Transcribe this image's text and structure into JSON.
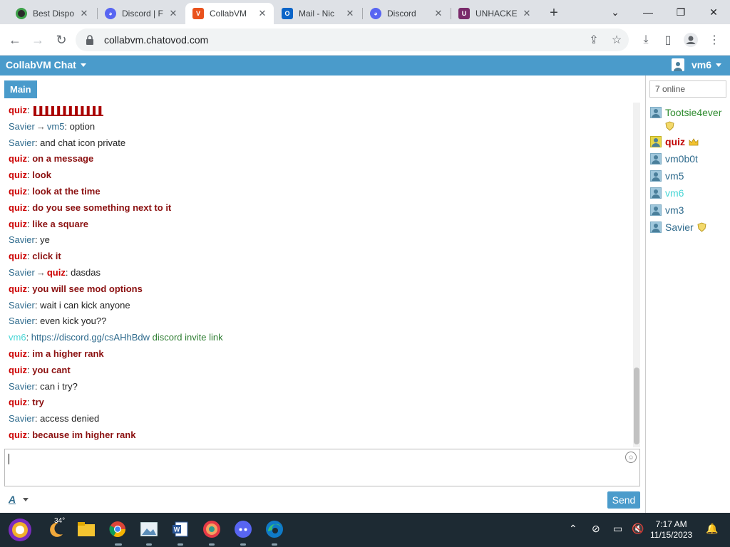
{
  "browser": {
    "tabs": [
      {
        "title": "Best Dispo",
        "icon": "xbox-icon"
      },
      {
        "title": "Discord | F",
        "icon": "discord-icon"
      },
      {
        "title": "CollabVM",
        "icon": "collabvm-icon"
      },
      {
        "title": "Mail - Nic",
        "icon": "outlook-icon"
      },
      {
        "title": "Discord",
        "icon": "discord-icon"
      },
      {
        "title": "UNHACKE",
        "icon": "unhacked-icon"
      }
    ],
    "active_tab": 2,
    "url": "collabvm.chatovod.com"
  },
  "app": {
    "title": "CollabVM Chat",
    "username": "vm6",
    "accent_color": "#4a9bcb"
  },
  "chat": {
    "room_tab": "Main",
    "messages": [
      {
        "from": "quiz",
        "text": "",
        "kind": "garbled"
      },
      {
        "from": "Savier",
        "to": "vm5",
        "text": "option"
      },
      {
        "from": "Savier",
        "text": "and chat icon private"
      },
      {
        "from": "quiz",
        "text": "on a message"
      },
      {
        "from": "quiz",
        "text": "look"
      },
      {
        "from": "quiz",
        "text": "look at the time"
      },
      {
        "from": "quiz",
        "text": "do you see something next to it"
      },
      {
        "from": "quiz",
        "text": "like a square"
      },
      {
        "from": "Savier",
        "text": "ye"
      },
      {
        "from": "quiz",
        "text": "click it"
      },
      {
        "from": "Savier",
        "to": "quiz",
        "text": "dasdas"
      },
      {
        "from": "quiz",
        "text": "you will see mod options"
      },
      {
        "from": "Savier",
        "text": "wait i can kick anyone"
      },
      {
        "from": "Savier",
        "text": "even kick you??"
      },
      {
        "from": "vm6",
        "link": "https://discord.gg/csAHhBdw",
        "text": "discord invite link"
      },
      {
        "from": "quiz",
        "text": "im a higher rank"
      },
      {
        "from": "quiz",
        "text": "you cant"
      },
      {
        "from": "Savier",
        "text": "can i try?"
      },
      {
        "from": "quiz",
        "text": "try"
      },
      {
        "from": "Savier",
        "text": "access denied"
      },
      {
        "from": "quiz",
        "text": "because im higher rank"
      }
    ],
    "input_value": "",
    "send_label": "Send",
    "font_label": "A"
  },
  "users_panel": {
    "online_count": "7 online",
    "users": [
      {
        "name": "Tootsie4ever",
        "color": "#2e8b2e",
        "badge": "shield-icon",
        "wrap": true
      },
      {
        "name": "quiz",
        "color": "#c00000",
        "badge": "crown-icon",
        "bold": true,
        "admin": true
      },
      {
        "name": "vm0b0t",
        "color": "#2f6b8d"
      },
      {
        "name": "vm5",
        "color": "#2f6b8d"
      },
      {
        "name": "vm6",
        "color": "#4ad6d6"
      },
      {
        "name": "vm3",
        "color": "#2f6b8d"
      },
      {
        "name": "Savier",
        "color": "#2f6b8d",
        "badge": "shield-icon"
      }
    ]
  },
  "taskbar": {
    "weather": "34°",
    "time": "7:17 AM",
    "date": "11/15/2023"
  }
}
